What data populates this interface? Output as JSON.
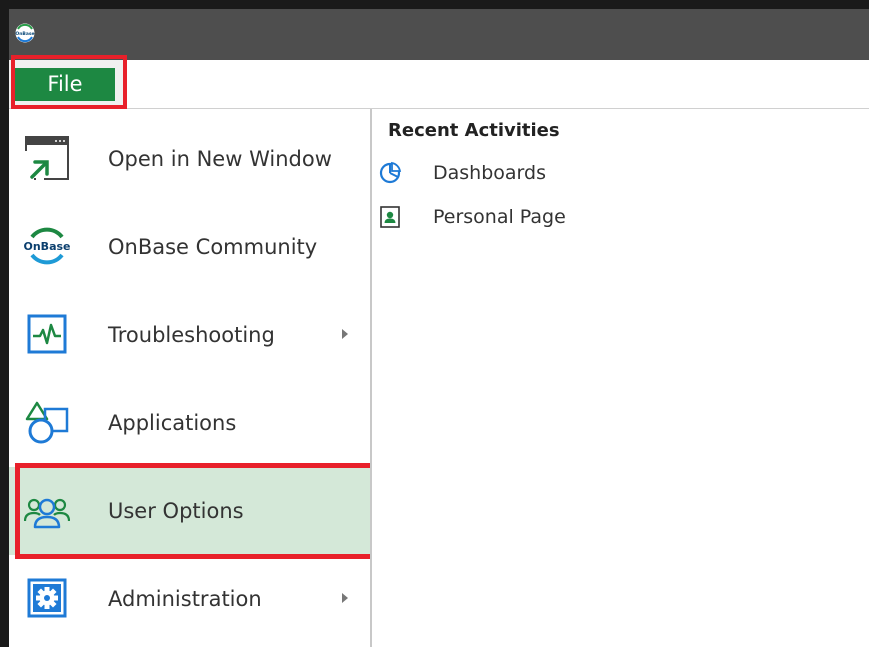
{
  "app": {
    "logo_text": "OnBase"
  },
  "menubar": {
    "file_label": "File"
  },
  "menu": {
    "items": [
      {
        "label": "Open in New Window",
        "icon": "open-new-window-icon",
        "submenu": false
      },
      {
        "label": "OnBase Community",
        "icon": "onbase-community-icon",
        "logo_text": "OnBase",
        "submenu": false
      },
      {
        "label": "Troubleshooting",
        "icon": "pulse-monitor-icon",
        "submenu": true
      },
      {
        "label": "Applications",
        "icon": "shapes-icon",
        "submenu": false
      },
      {
        "label": "User Options",
        "icon": "users-icon",
        "submenu": false,
        "selected": true
      },
      {
        "label": "Administration",
        "icon": "gear-icon",
        "submenu": true
      }
    ]
  },
  "recent": {
    "title": "Recent Activities",
    "items": [
      {
        "label": "Dashboards",
        "icon": "pie-chart-icon"
      },
      {
        "label": "Personal Page",
        "icon": "person-page-icon"
      }
    ]
  },
  "colors": {
    "accent_green": "#1d8842",
    "highlight_red": "#e8202a",
    "selected_bg": "#d4e8d8",
    "titlebar": "#4e4e4e",
    "icon_blue": "#1e7ad6"
  }
}
